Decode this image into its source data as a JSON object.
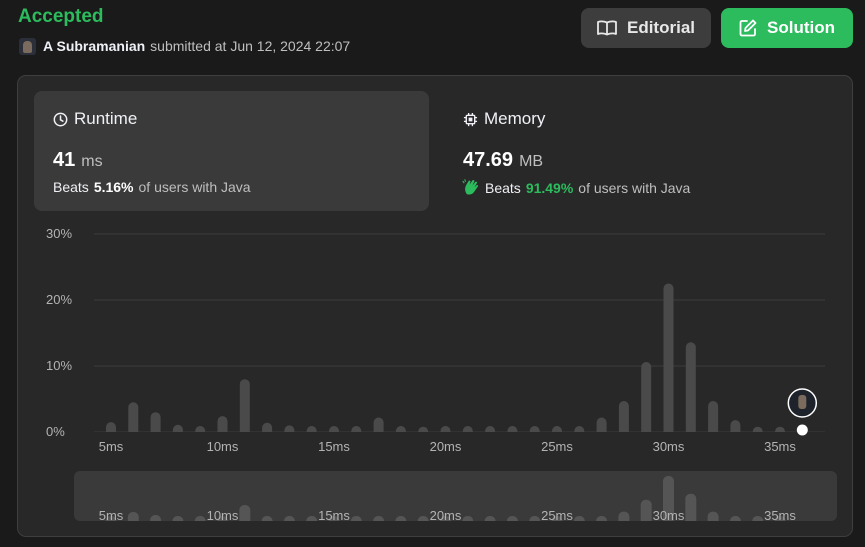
{
  "header": {
    "status": "Accepted",
    "username": "A Subramanian",
    "submitted_text": "submitted at Jun 12, 2024 22:07",
    "editorial_label": "Editorial",
    "solution_label": "Solution",
    "accent_color": "#2cbb5d"
  },
  "runtime": {
    "title": "Runtime",
    "value": "41",
    "unit": "ms",
    "beats_word": "Beats",
    "beats_pct": "5.16%",
    "beats_suffix": "of users with Java",
    "icon": "clock-icon"
  },
  "memory": {
    "title": "Memory",
    "value": "47.69",
    "unit": "MB",
    "beats_word": "Beats",
    "beats_pct": "91.49%",
    "beats_suffix": "of users with Java",
    "icon": "chip-icon",
    "beats_icon": "clap-icon"
  },
  "chart_data": {
    "type": "bar",
    "xlabel": "",
    "ylabel": "",
    "ylim": [
      0,
      30
    ],
    "y_ticks": [
      "30%",
      "20%",
      "10%",
      "0%"
    ],
    "y_tick_values": [
      30,
      20,
      10,
      0
    ],
    "x_ticks": [
      "5ms",
      "10ms",
      "15ms",
      "20ms",
      "25ms",
      "30ms",
      "35ms"
    ],
    "x_tick_values": [
      5,
      10,
      15,
      20,
      25,
      30,
      35
    ],
    "x": [
      5,
      6,
      7,
      8,
      9,
      10,
      11,
      12,
      13,
      14,
      15,
      16,
      17,
      18,
      19,
      20,
      21,
      22,
      23,
      24,
      25,
      26,
      27,
      28,
      29,
      30,
      31,
      32,
      33,
      34,
      35
    ],
    "values": [
      1.5,
      4.5,
      3.0,
      1.1,
      0.9,
      2.4,
      8.0,
      1.4,
      1.0,
      0.9,
      0.9,
      0.9,
      2.2,
      0.9,
      0.8,
      0.9,
      0.9,
      0.9,
      0.9,
      0.9,
      0.9,
      0.9,
      2.2,
      4.7,
      10.6,
      22.5,
      13.6,
      4.7,
      1.8,
      0.8,
      0.8
    ],
    "your_value": 36,
    "grid": true,
    "bar_color": "#4a4a4a",
    "grid_color": "#3c3c3c"
  },
  "overview": {
    "x_ticks": [
      "5ms",
      "10ms",
      "15ms",
      "20ms",
      "25ms",
      "30ms",
      "35ms"
    ]
  }
}
